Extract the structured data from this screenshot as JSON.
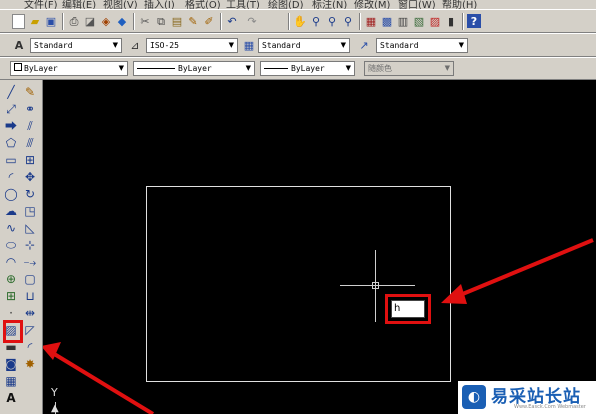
{
  "menu": [
    "文件(F)",
    "编辑(E)",
    "视图(V)",
    "插入(I)",
    "格式(O)",
    "工具(T)",
    "绘图(D)",
    "标注(N)",
    "修改(M)",
    "窗口(W)",
    "帮助(H)"
  ],
  "styles_toolbar": {
    "text_style": "Standard",
    "dim_style": "ISO-25",
    "table_style": "Standard",
    "multileader_style": "Standard"
  },
  "layers_toolbar": {
    "color": "ByLayer",
    "linetype": "ByLayer",
    "lineweight": "ByLayer",
    "plot_style": "随颜色"
  },
  "dynamic_input": {
    "value": "h"
  },
  "ucs": {
    "y_label": "Y"
  },
  "watermark": {
    "title": "易采站长站",
    "subtitle": "Www.Easck.Com Webmaster"
  },
  "colors": {
    "canvas": "#000000",
    "highlight": "#e01010",
    "toolbar": "#d4d0c8"
  },
  "icons": {
    "standard": [
      "new-icon",
      "open-icon",
      "save-icon",
      "print-icon",
      "preview-icon",
      "publish-icon",
      "3d-dwf-icon",
      "cut-icon",
      "copy-icon",
      "paste-icon",
      "match-properties-icon",
      "block-editor-icon",
      "undo-icon",
      "redo-icon",
      "pan-icon",
      "zoom-realtime-icon",
      "zoom-window-icon",
      "zoom-previous-icon",
      "properties-icon",
      "design-center-icon",
      "tool-palettes-icon",
      "sheet-set-icon",
      "markup-icon",
      "calculator-icon",
      "help-icon"
    ],
    "draw": [
      "line-icon",
      "construction-line-icon",
      "polyline-icon",
      "polygon-icon",
      "rectangle-icon",
      "arc-icon",
      "circle-icon",
      "revision-cloud-icon",
      "spline-icon",
      "ellipse-icon",
      "ellipse-arc-icon",
      "insert-block-icon",
      "make-block-icon",
      "point-icon",
      "hatch-icon",
      "gradient-icon",
      "region-icon",
      "table-icon",
      "multiline-text-icon"
    ],
    "modify": [
      "erase-icon",
      "copy-object-icon",
      "mirror-icon",
      "offset-icon",
      "array-icon",
      "move-icon",
      "rotate-icon",
      "scale-icon",
      "stretch-icon",
      "trim-icon",
      "extend-icon",
      "break-at-point-icon",
      "break-icon",
      "join-icon",
      "chamfer-icon",
      "fillet-icon",
      "explode-icon"
    ]
  }
}
